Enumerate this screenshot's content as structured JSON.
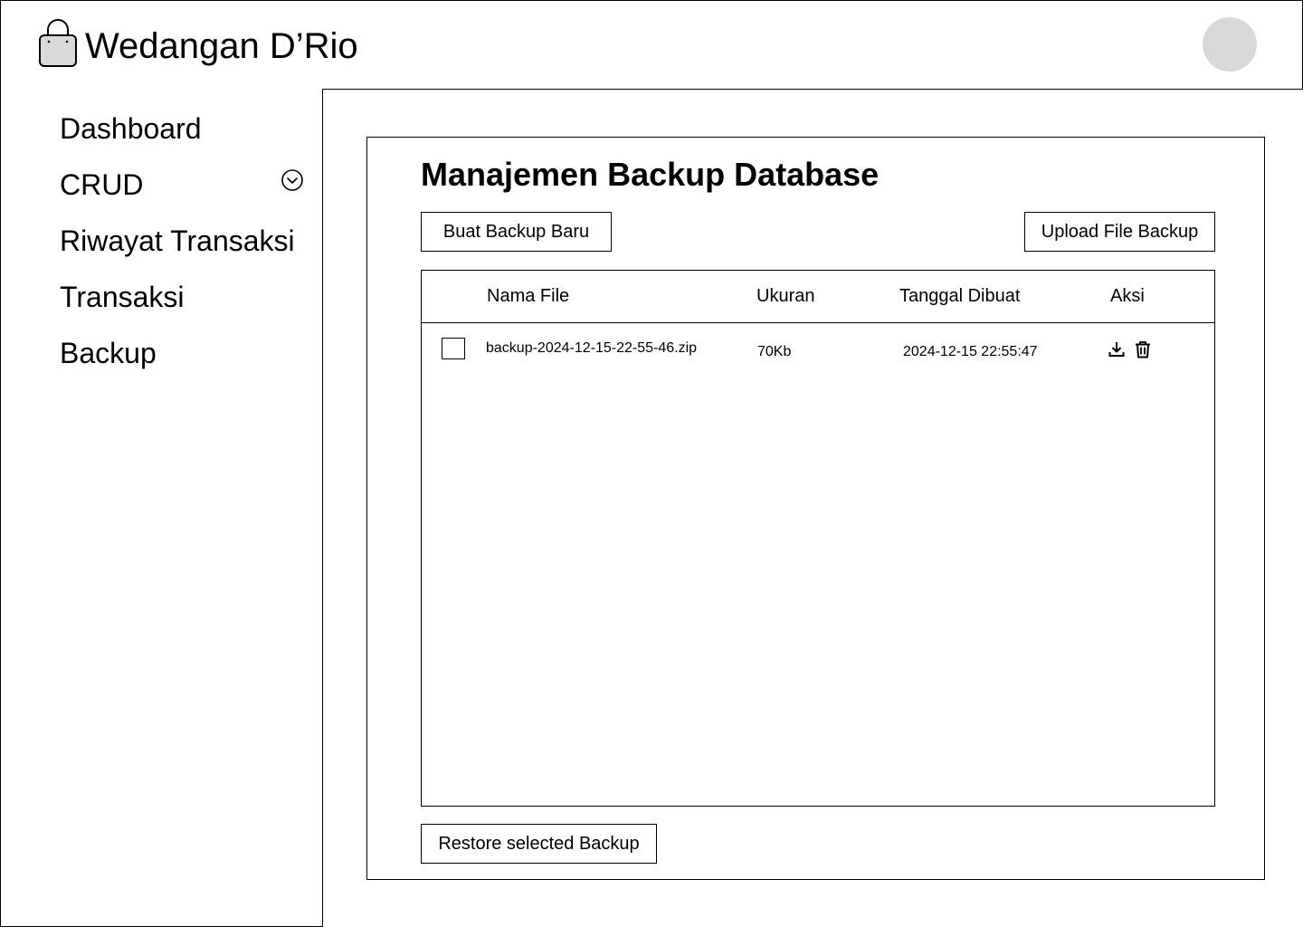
{
  "header": {
    "app_title": "Wedangan D’Rio",
    "logo_icon": "shopping-bag-icon",
    "avatar_color": "#d9d9d9"
  },
  "sidebar": {
    "items": [
      {
        "label": "Dashboard"
      },
      {
        "label": "CRUD",
        "icon": "chevron-down-circle-icon"
      },
      {
        "label": "Riwayat Transaksi"
      },
      {
        "label": "Transaksi"
      },
      {
        "label": "Backup"
      }
    ]
  },
  "main": {
    "title": "Manajemen Backup Database",
    "create_button": "Buat Backup Baru",
    "upload_button": "Upload File Backup",
    "restore_button": "Restore selected Backup",
    "table": {
      "columns": [
        "Nama File",
        "Ukuran",
        "Tanggal Dibuat",
        "Aksi"
      ],
      "rows": [
        {
          "checked": false,
          "file_name": "backup-2024-12-15-22-55-46.zip",
          "size": "70Kb",
          "created": "2024-12-15 22:55:47",
          "actions": [
            "download-icon",
            "trash-icon"
          ]
        }
      ]
    }
  }
}
